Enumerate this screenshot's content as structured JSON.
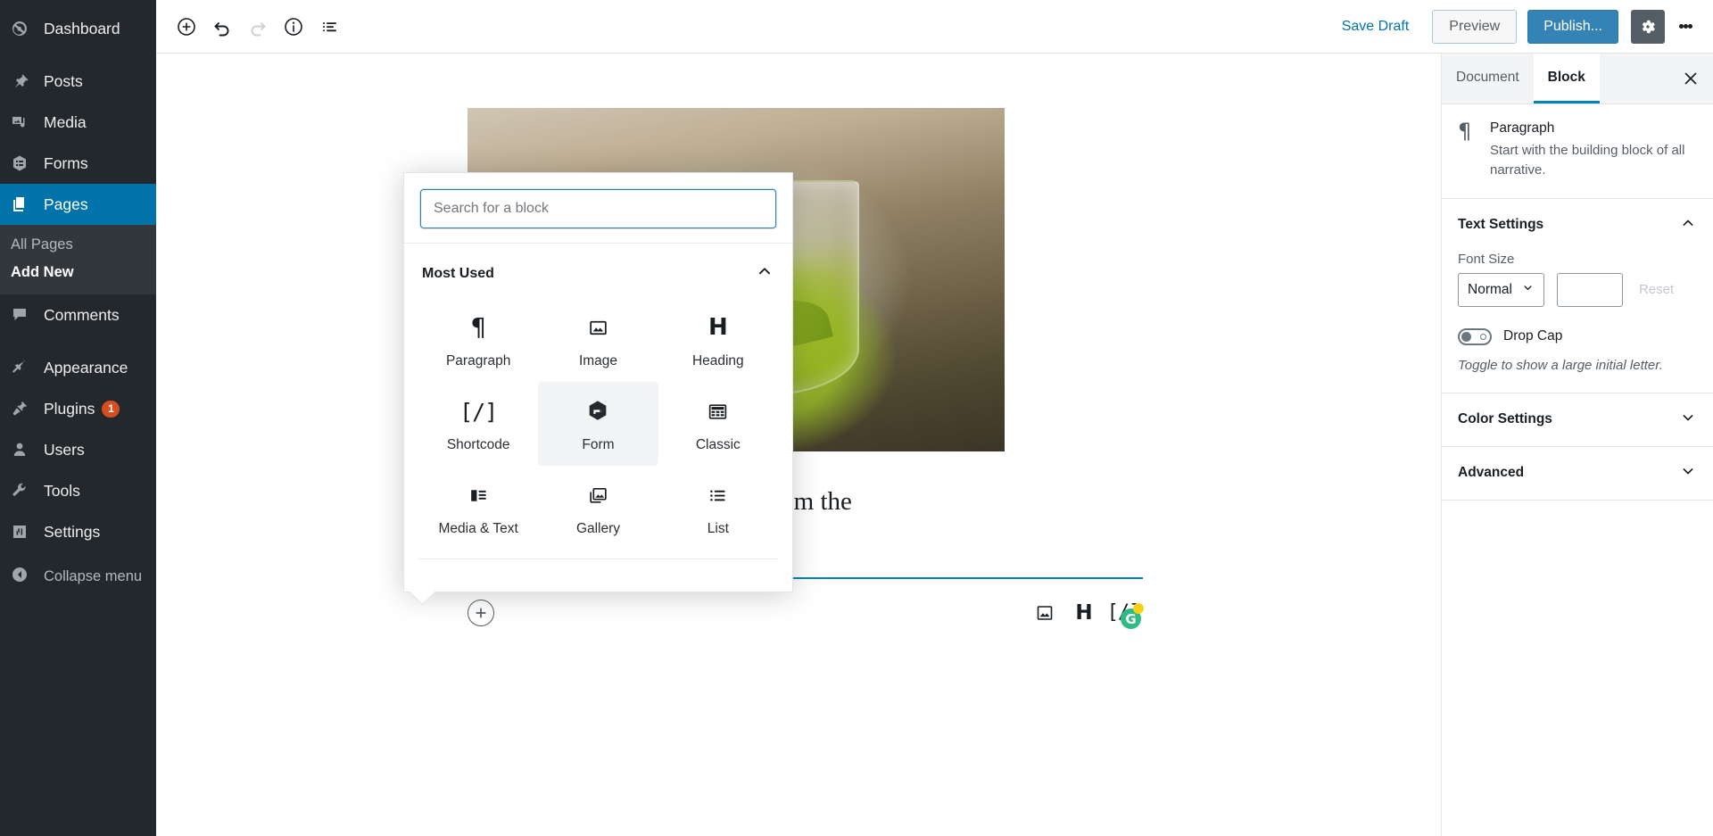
{
  "admin_menu": {
    "items": [
      {
        "label": "Dashboard",
        "icon": "dashboard-icon",
        "active": false,
        "separator": false
      },
      {
        "label": "Posts",
        "icon": "pin-icon",
        "active": false,
        "separator": true
      },
      {
        "label": "Media",
        "icon": "media-icon",
        "active": false,
        "separator": false
      },
      {
        "label": "Forms",
        "icon": "forms-icon",
        "active": false,
        "separator": false
      },
      {
        "label": "Pages",
        "icon": "pages-icon",
        "active": true,
        "separator": false
      },
      {
        "label": "Comments",
        "icon": "comments-icon",
        "active": false,
        "separator": false
      },
      {
        "label": "Appearance",
        "icon": "brush-icon",
        "active": false,
        "separator": true
      },
      {
        "label": "Plugins",
        "icon": "plugin-icon",
        "active": false,
        "separator": false,
        "badge": "1"
      },
      {
        "label": "Users",
        "icon": "user-icon",
        "active": false,
        "separator": false
      },
      {
        "label": "Tools",
        "icon": "wrench-icon",
        "active": false,
        "separator": false
      },
      {
        "label": "Settings",
        "icon": "settings-icon",
        "active": false,
        "separator": false
      }
    ],
    "submenu": [
      {
        "label": "All Pages",
        "current": false
      },
      {
        "label": "Add New",
        "current": true
      }
    ],
    "collapse_label": "Collapse menu",
    "accent_color": "#0073aa",
    "badge_color": "#d54e21"
  },
  "header": {
    "tools": [
      {
        "name": "add-block-icon",
        "title": "Add block"
      },
      {
        "name": "undo-icon",
        "title": "Undo"
      },
      {
        "name": "redo-icon",
        "title": "Redo",
        "disabled": true
      },
      {
        "name": "info-icon",
        "title": "Content structure"
      },
      {
        "name": "block-navigation-icon",
        "title": "Block navigation"
      }
    ],
    "save_draft_label": "Save Draft",
    "preview_label": "Preview",
    "publish_label": "Publish...",
    "settings_icon": "gear-icon",
    "more_icon": "kebab-menu-icon",
    "publish_color": "#3582b5",
    "link_color": "#0073aa"
  },
  "inserter": {
    "search_placeholder": "Search for a block",
    "search_value": "",
    "panel_title": "Most Used",
    "collapse_icon": "chevron-up-icon",
    "blocks": [
      {
        "label": "Paragraph",
        "icon": "paragraph-icon",
        "selected": false
      },
      {
        "label": "Image",
        "icon": "image-icon",
        "selected": false
      },
      {
        "label": "Heading",
        "icon": "heading-icon",
        "selected": false
      },
      {
        "label": "Shortcode",
        "icon": "shortcode-icon",
        "selected": false
      },
      {
        "label": "Form",
        "icon": "gravity-forms-icon",
        "selected": true
      },
      {
        "label": "Classic",
        "icon": "classic-icon",
        "selected": false
      },
      {
        "label": "Media & Text",
        "icon": "media-text-icon",
        "selected": false
      },
      {
        "label": "Gallery",
        "icon": "gallery-icon",
        "selected": false
      },
      {
        "label": "List",
        "icon": "list-icon",
        "selected": false
      }
    ]
  },
  "canvas": {
    "paragraph_text": "your senses. Brought to you from the",
    "quick_inserts": [
      {
        "name": "image-icon"
      },
      {
        "name": "heading-icon"
      },
      {
        "name": "shortcode-icon"
      }
    ],
    "gravity_badge_letter": "G",
    "add_block_icon": "plus-circle-icon"
  },
  "settings": {
    "tabs": [
      {
        "label": "Document",
        "active": false
      },
      {
        "label": "Block",
        "active": true
      }
    ],
    "close_icon": "close-icon",
    "block_card": {
      "icon": "paragraph-icon",
      "name": "Paragraph",
      "description": "Start with the building block of all narrative."
    },
    "sections": [
      {
        "title": "Text Settings",
        "expanded": true,
        "chevron": "chevron-up-icon"
      },
      {
        "title": "Color Settings",
        "expanded": false,
        "chevron": "chevron-down-icon"
      },
      {
        "title": "Advanced",
        "expanded": false,
        "chevron": "chevron-down-icon"
      }
    ],
    "font_size": {
      "label": "Font Size",
      "selected": "Normal",
      "custom_value": "",
      "reset_label": "Reset",
      "chevron": "chevron-down-icon"
    },
    "drop_cap": {
      "label": "Drop Cap",
      "enabled": false,
      "help": "Toggle to show a large initial letter."
    },
    "accent_color": "#0085ba"
  }
}
